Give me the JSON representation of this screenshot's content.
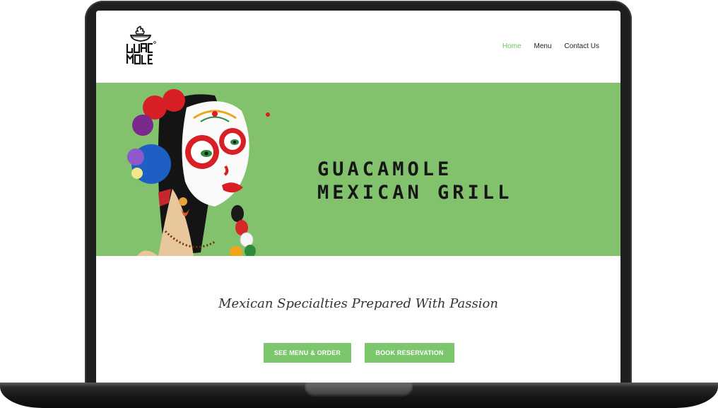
{
  "header": {
    "logo_alt": "Guacamole",
    "nav": [
      {
        "label": "Home",
        "active": true
      },
      {
        "label": "Menu",
        "active": false
      },
      {
        "label": "Contact Us",
        "active": false
      }
    ]
  },
  "hero": {
    "title_line1": "GUACAMOLE",
    "title_line2": "MEXICAN GRILL",
    "background": "#82c26c"
  },
  "tagline": "Mexican Specialties Prepared With Passion",
  "buttons": {
    "menu_label": "SEE MENU & ORDER",
    "book_label": "BOOK RESERVATION",
    "color": "#7cc66b"
  },
  "colors": {
    "accent": "#6fbf5f",
    "laptop_frame": "#1f1f1f"
  }
}
